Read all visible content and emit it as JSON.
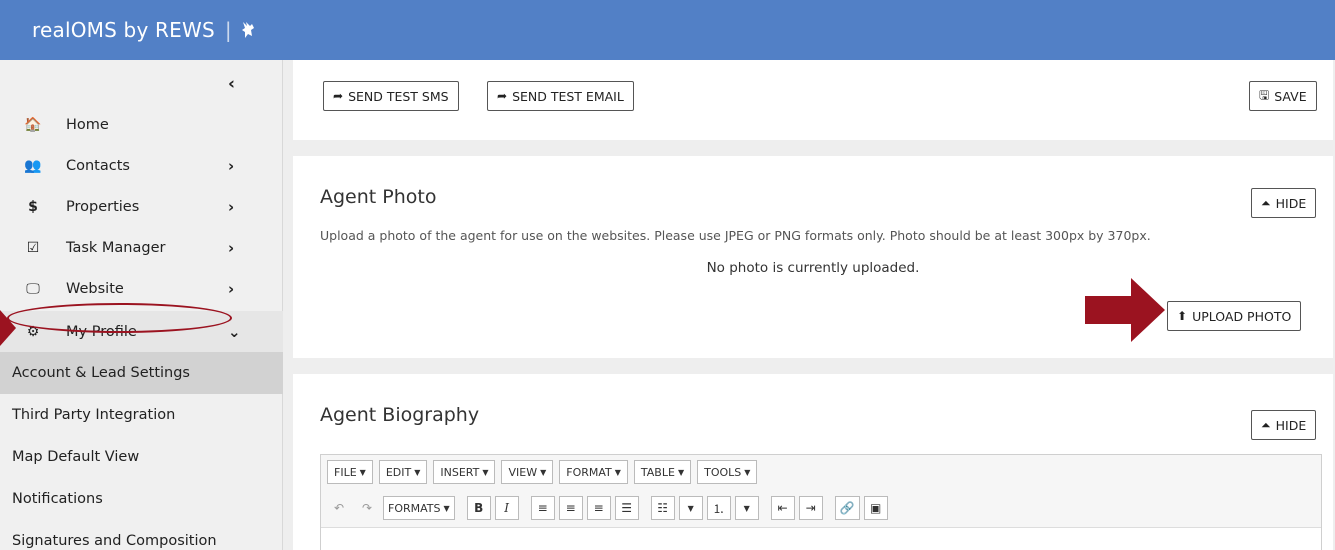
{
  "app": {
    "title": "realOMS by REWS",
    "separator": "|"
  },
  "sidebar": {
    "items": [
      {
        "label": "Home",
        "icon": "home-icon",
        "glyph": "🏠"
      },
      {
        "label": "Contacts",
        "icon": "users-icon",
        "glyph": "👥"
      },
      {
        "label": "Properties",
        "icon": "dollar-icon",
        "glyph": "$"
      },
      {
        "label": "Task Manager",
        "icon": "calendar-check-icon",
        "glyph": "☑"
      },
      {
        "label": "Website",
        "icon": "monitor-icon",
        "glyph": "🖵"
      },
      {
        "label": "My Profile",
        "icon": "gear-icon",
        "glyph": "⚙"
      }
    ],
    "subitems": [
      {
        "label": "Account & Lead Settings"
      },
      {
        "label": "Third Party Integration"
      },
      {
        "label": "Map Default View"
      },
      {
        "label": "Notifications"
      },
      {
        "label": "Signatures and Composition"
      }
    ]
  },
  "toolbar": {
    "send_sms": "SEND TEST SMS",
    "send_email": "SEND TEST EMAIL",
    "save": "SAVE"
  },
  "photo": {
    "title": "Agent Photo",
    "hide": "HIDE",
    "description": "Upload a photo of the agent for use on the websites. Please use JPEG or PNG formats only. Photo should be at least 300px by 370px.",
    "status": "No photo is currently uploaded.",
    "upload": "UPLOAD PHOTO"
  },
  "bio": {
    "title": "Agent Biography",
    "hide": "HIDE",
    "menus": [
      "FILE",
      "EDIT",
      "INSERT",
      "VIEW",
      "FORMAT",
      "TABLE",
      "TOOLS"
    ],
    "formats": "FORMATS",
    "bold": "B",
    "italic": "I"
  },
  "colors": {
    "header": "#5280c6",
    "annotation": "#9b1320"
  }
}
